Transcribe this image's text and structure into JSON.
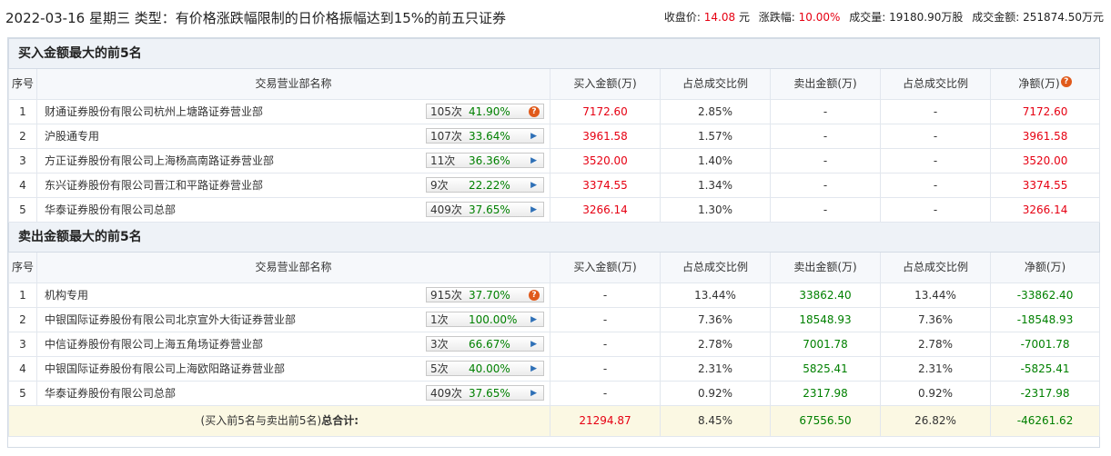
{
  "header": {
    "title": "2022-03-16 星期三 类型：有价格涨跌幅限制的日价格振幅达到15%的前五只证券",
    "close_label": "收盘价:",
    "close_value": "14.08",
    "close_unit": "元",
    "change_label": "涨跌幅:",
    "change_value": "10.00%",
    "volume_label": "成交量:",
    "volume_value": "19180.90万股",
    "amount_label": "成交金额:",
    "amount_value": "251874.50万元"
  },
  "columns": [
    "序号",
    "交易营业部名称",
    "买入金额(万)",
    "占总成交比例",
    "卖出金额(万)",
    "占总成交比例",
    "净额(万)"
  ],
  "buy_section": {
    "title": "买入金额最大的前5名",
    "rows": [
      {
        "no": "1",
        "name": "财通证券股份有限公司杭州上塘路证券营业部",
        "times": "105次",
        "rate": "41.90%",
        "icon": "question",
        "buy": "7172.60",
        "buy_ratio": "2.85%",
        "sell": "-",
        "sell_ratio": "-",
        "net": "7172.60"
      },
      {
        "no": "2",
        "name": "沪股通专用",
        "times": "107次",
        "rate": "33.64%",
        "icon": "arrow",
        "buy": "3961.58",
        "buy_ratio": "1.57%",
        "sell": "-",
        "sell_ratio": "-",
        "net": "3961.58"
      },
      {
        "no": "3",
        "name": "方正证券股份有限公司上海杨高南路证券营业部",
        "times": "11次",
        "rate": "36.36%",
        "icon": "arrow",
        "buy": "3520.00",
        "buy_ratio": "1.40%",
        "sell": "-",
        "sell_ratio": "-",
        "net": "3520.00"
      },
      {
        "no": "4",
        "name": "东兴证券股份有限公司晋江和平路证券营业部",
        "times": "9次",
        "rate": "22.22%",
        "icon": "arrow",
        "buy": "3374.55",
        "buy_ratio": "1.34%",
        "sell": "-",
        "sell_ratio": "-",
        "net": "3374.55"
      },
      {
        "no": "5",
        "name": "华泰证券股份有限公司总部",
        "times": "409次",
        "rate": "37.65%",
        "icon": "arrow",
        "buy": "3266.14",
        "buy_ratio": "1.30%",
        "sell": "-",
        "sell_ratio": "-",
        "net": "3266.14"
      }
    ]
  },
  "sell_section": {
    "title": "卖出金额最大的前5名",
    "rows": [
      {
        "no": "1",
        "name": "机构专用",
        "times": "915次",
        "rate": "37.70%",
        "icon": "question",
        "buy": "-",
        "buy_ratio": "13.44%",
        "sell": "33862.40",
        "sell_ratio": "13.44%",
        "net": "-33862.40"
      },
      {
        "no": "2",
        "name": "中银国际证券股份有限公司北京宣外大街证券营业部",
        "times": "1次",
        "rate": "100.00%",
        "icon": "arrow",
        "buy": "-",
        "buy_ratio": "7.36%",
        "sell": "18548.93",
        "sell_ratio": "7.36%",
        "net": "-18548.93"
      },
      {
        "no": "3",
        "name": "中信证券股份有限公司上海五角场证券营业部",
        "times": "3次",
        "rate": "66.67%",
        "icon": "arrow",
        "buy": "-",
        "buy_ratio": "2.78%",
        "sell": "7001.78",
        "sell_ratio": "2.78%",
        "net": "-7001.78"
      },
      {
        "no": "4",
        "name": "中银国际证券股份有限公司上海欧阳路证券营业部",
        "times": "5次",
        "rate": "40.00%",
        "icon": "arrow",
        "buy": "-",
        "buy_ratio": "2.31%",
        "sell": "5825.41",
        "sell_ratio": "2.31%",
        "net": "-5825.41"
      },
      {
        "no": "5",
        "name": "华泰证券股份有限公司总部",
        "times": "409次",
        "rate": "37.65%",
        "icon": "arrow",
        "buy": "-",
        "buy_ratio": "0.92%",
        "sell": "2317.98",
        "sell_ratio": "0.92%",
        "net": "-2317.98"
      }
    ]
  },
  "total": {
    "label_prefix": "(买入前5名与卖出前5名)",
    "label_bold": "总合计:",
    "buy": "21294.87",
    "buy_ratio": "8.45%",
    "sell": "67556.50",
    "sell_ratio": "26.82%",
    "net": "-46261.62"
  },
  "icons": {
    "question": "question-icon",
    "arrow": "play-arrow-icon",
    "help_glyph": "?",
    "arrow_glyph": "▶"
  },
  "colors": {
    "positive": "#e60012",
    "negative": "#008000",
    "section_bg": "#eef2f7",
    "total_bg": "#fbf8e3"
  }
}
